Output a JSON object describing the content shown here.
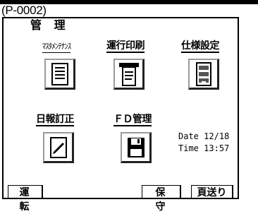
{
  "screen_id": "(P-0002)",
  "section_title": "管 理",
  "buttons": {
    "maintenance": {
      "label": "ﾏｽﾀﾒﾝﾃﾅﾝｽ"
    },
    "daily_print": {
      "label": "運行印刷"
    },
    "spec_settings": {
      "label": "仕様設定"
    },
    "daily_correction": {
      "label": "日報訂正"
    },
    "fd_management": {
      "label": "ＦＤ管理"
    }
  },
  "status": {
    "date_label": "Date",
    "date_value": "12/18",
    "time_label": "Time",
    "time_value": "13:57"
  },
  "footer": {
    "left_button": "運 転",
    "maintenance_button": "保 守",
    "next_page_button": "頁送り"
  }
}
